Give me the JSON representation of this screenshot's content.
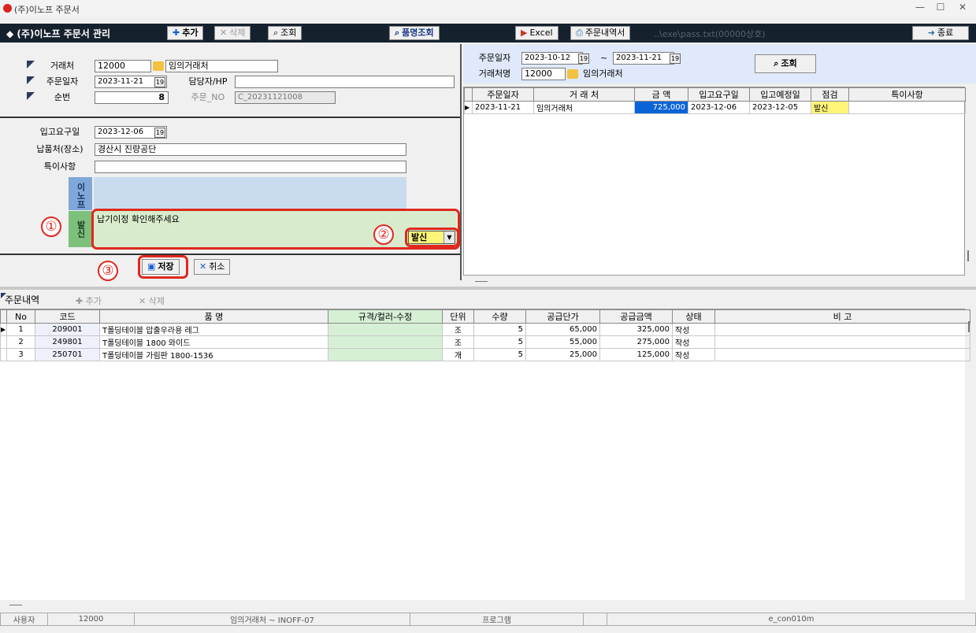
{
  "window": {
    "title": "(주)이노프 주문서",
    "min": "—",
    "max": "☐",
    "close": "✕"
  },
  "toolbar": {
    "title": "◆ (주)이노프 주문서 관리",
    "add": "추가",
    "delete": "삭제",
    "search": "조회",
    "item_search": "품명조회",
    "excel": "Excel",
    "order_list": "주문내역서",
    "path": "..\\exe\\pass.txt(00000상호)",
    "exit": "종료"
  },
  "form": {
    "client_label": "거래처",
    "client_code": "12000",
    "client_name": "임의거래처",
    "order_date_label": "주문일자",
    "order_date": "2023-11-21",
    "manager_label": "담당자/HP",
    "manager_value": "",
    "seq_label": "순번",
    "seq_value": "8",
    "order_no_label": "주문_NO",
    "order_no": "C_20231121008",
    "req_date_label": "입고요구일",
    "req_date": "2023-12-06",
    "place_label": "납품처(장소)",
    "place_value": "경산시 진량공단",
    "notes_label": "특이사항",
    "notes_value": "",
    "inof_tab": "이노프",
    "send_tab": "발신",
    "send_message": "납기이정 확인해주세요",
    "status_value": "발신",
    "save_label": "저장",
    "cancel_label": "취소"
  },
  "annotations": {
    "one": "①",
    "two": "②",
    "three": "③"
  },
  "search_panel": {
    "date_label": "주문일자",
    "date_from": "2023-10-12",
    "tilde": "~",
    "date_to": "2023-11-21",
    "client_label": "거래처명",
    "client_code": "12000",
    "client_name": "임의거래처",
    "search_btn": "조회"
  },
  "order_list": {
    "headers": [
      "주문일자",
      "거 래 처",
      "금 액",
      "입고요구일",
      "입고예정일",
      "점검",
      "특이사항"
    ],
    "rows": [
      {
        "date": "2023-11-21",
        "client": "임의거래처",
        "amount": "725,000",
        "req": "2023-12-06",
        "due": "2023-12-05",
        "check": "발신",
        "note": ""
      }
    ]
  },
  "detail": {
    "tab_label": "주문내역",
    "add": "추가",
    "delete": "삭제",
    "headers": [
      "No",
      "코드",
      "품 명",
      "규격/컬러-수정",
      "단위",
      "수량",
      "공급단가",
      "공급금액",
      "상태",
      "비 고"
    ],
    "rows": [
      {
        "no": "1",
        "code": "209001",
        "name": "T폴딩테이블 압출우라용 레그",
        "spec": "",
        "unit": "조",
        "qty": "5",
        "price": "65,000",
        "amount": "325,000",
        "status": "작성",
        "note": ""
      },
      {
        "no": "2",
        "code": "249801",
        "name": "T폴딩테이블 1800 와이드",
        "spec": "",
        "unit": "조",
        "qty": "5",
        "price": "55,000",
        "amount": "275,000",
        "status": "작성",
        "note": ""
      },
      {
        "no": "3",
        "code": "250701",
        "name": "T폴딩테이블 가림판 1800-1536",
        "spec": "",
        "unit": "개",
        "qty": "5",
        "price": "25,000",
        "amount": "125,000",
        "status": "작성",
        "note": ""
      }
    ]
  },
  "statusbar": {
    "user_label": "사용자",
    "user_value": "12000",
    "client_info": "임의거래처 ~ INOFF-07",
    "program_label": "프로그램",
    "program_value": "",
    "form_id": "e_con010m"
  },
  "colors": {
    "toolbar_bg": "#16212e",
    "highlight_red": "#e0281e",
    "send_yellow": "#fff579",
    "amount_blue": "#0a64d8",
    "spec_green": "#d6f0d6"
  }
}
